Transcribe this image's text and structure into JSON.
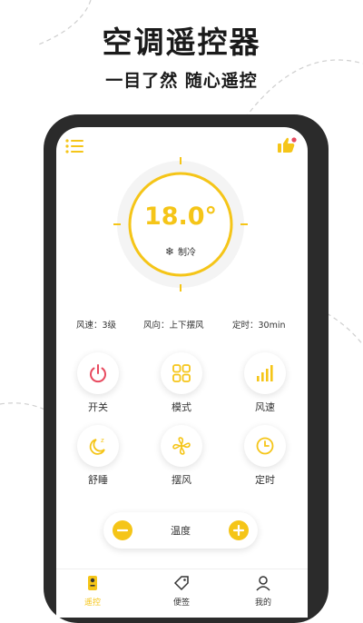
{
  "promo": {
    "title": "空调遥控器",
    "subtitle": "一目了然  随心遥控"
  },
  "colors": {
    "accent": "#f5c518",
    "power": "#e84a5f",
    "frame": "#2b2b2b"
  },
  "header": {
    "menu_icon": "list-icon",
    "like_icon": "thumbs-up-icon"
  },
  "dial": {
    "temperature": "18.0°",
    "mode_icon": "snowflake-icon",
    "mode_label": "制冷"
  },
  "status": {
    "fan_speed": "风速：3级",
    "swing": "风向：上下摆风",
    "timer": "定时：30min"
  },
  "controls": [
    {
      "label": "开关",
      "icon": "power-icon"
    },
    {
      "label": "模式",
      "icon": "grid-icon"
    },
    {
      "label": "风速",
      "icon": "signal-bars-icon"
    },
    {
      "label": "舒睡",
      "icon": "moon-sleep-icon"
    },
    {
      "label": "摆风",
      "icon": "fan-icon"
    },
    {
      "label": "定时",
      "icon": "clock-icon"
    }
  ],
  "temp_control": {
    "label": "温度",
    "minus_icon": "minus-icon",
    "plus_icon": "plus-icon"
  },
  "nav": [
    {
      "label": "遥控",
      "icon": "remote-icon",
      "active": true
    },
    {
      "label": "便签",
      "icon": "tag-icon",
      "active": false
    },
    {
      "label": "我的",
      "icon": "user-icon",
      "active": false
    }
  ]
}
